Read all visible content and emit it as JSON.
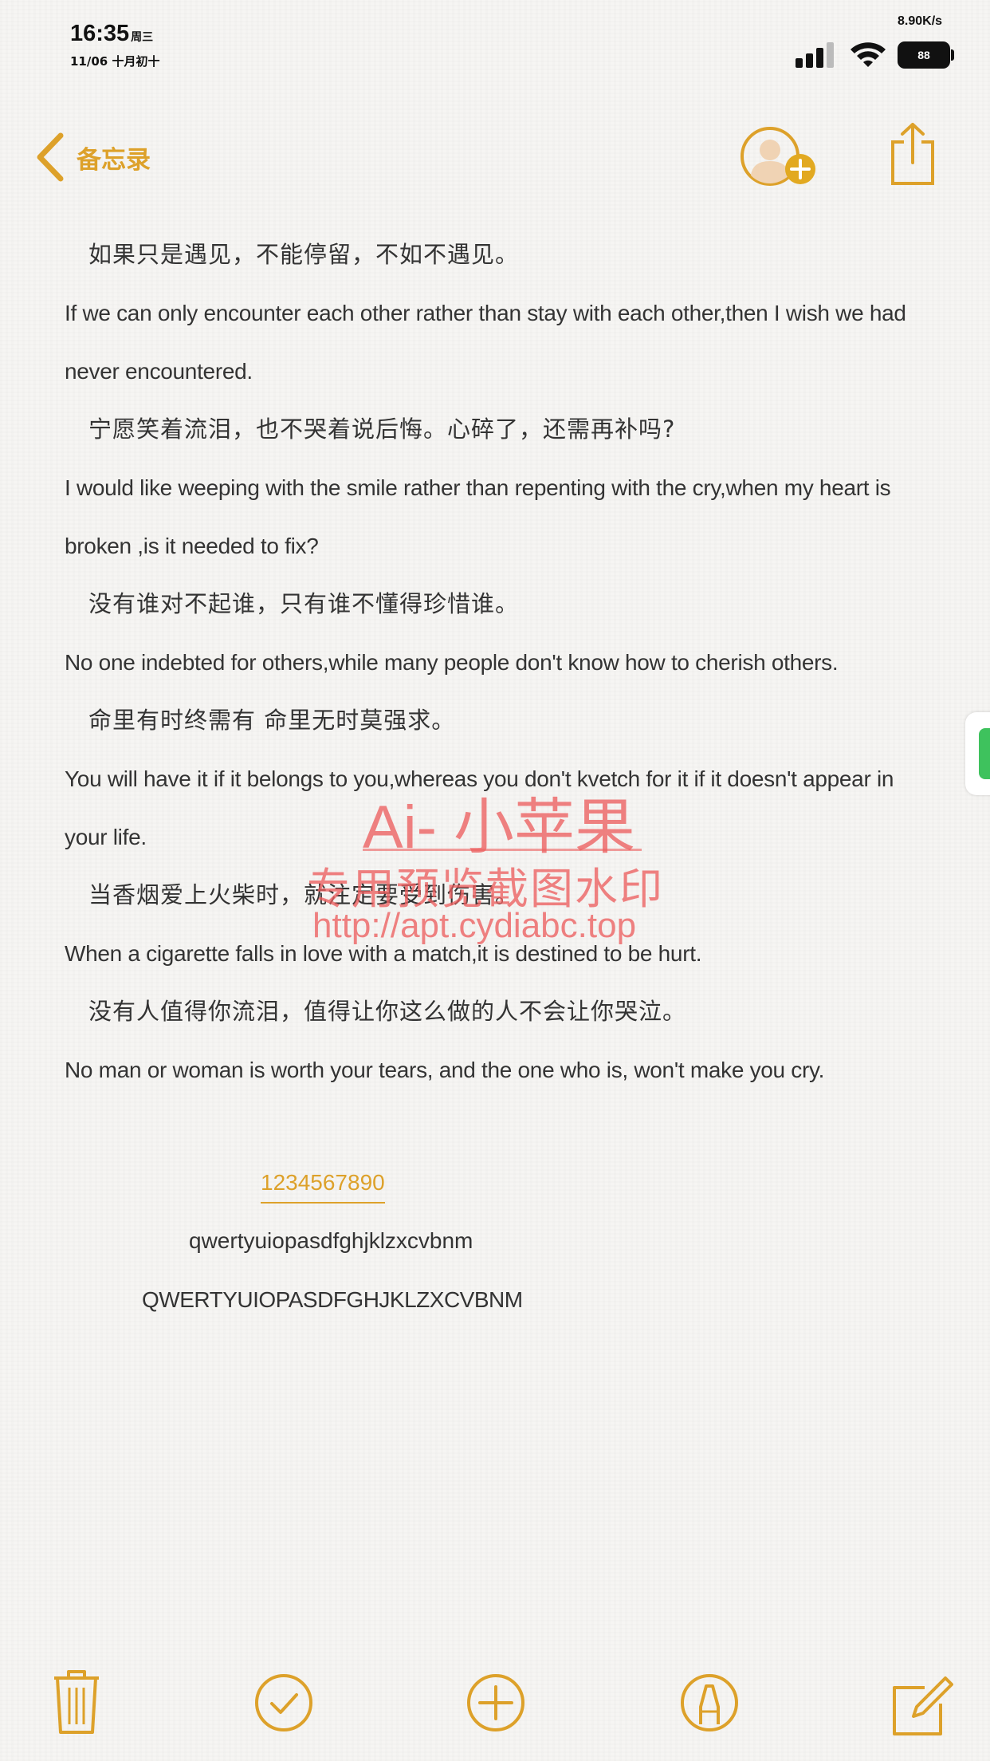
{
  "status_bar": {
    "time": "16:35",
    "weekday": "周三",
    "date": "11/06 十月初十",
    "net_speed": "8.90K/s",
    "battery": "88"
  },
  "nav": {
    "back_label": "备忘录"
  },
  "note": {
    "lines": [
      {
        "lang": "cn",
        "text": "如果只是遇见，不能停留，不如不遇见。"
      },
      {
        "lang": "en",
        "text": "If we can only encounter each other rather than stay with each other,then I wish we had"
      },
      {
        "lang": "en",
        "text": "never encountered."
      },
      {
        "lang": "cn",
        "text": "宁愿笑着流泪，也不哭着说后悔。心碎了，还需再补吗?"
      },
      {
        "lang": "en",
        "text": "I would like weeping with the smile rather than repenting with the cry,when my heart is"
      },
      {
        "lang": "en",
        "text": "broken ,is it needed to fix?"
      },
      {
        "lang": "cn",
        "text": "没有谁对不起谁，只有谁不懂得珍惜谁。"
      },
      {
        "lang": "en",
        "text": "No one indebted for others,while many people don't know how to cherish others."
      },
      {
        "lang": "cn",
        "text": "命里有时终需有 命里无时莫强求。"
      },
      {
        "lang": "en",
        "text": "You will have it if it belongs to you,whereas you don't kvetch for it if it doesn't appear in"
      },
      {
        "lang": "en",
        "text": "your life."
      },
      {
        "lang": "cn",
        "text": "当香烟爱上火柴时，就注定要受到伤害。"
      },
      {
        "lang": "en",
        "text": "When a cigarette falls in love with a match,it is destined to be hurt."
      },
      {
        "lang": "cn",
        "text": "没有人值得你流泪，值得让你这么做的人不会让你哭泣。"
      },
      {
        "lang": "en",
        "text": "No man or woman is worth your tears, and the one who is, won't make you cry."
      }
    ],
    "digits": "1234567890",
    "lowercase": "qwertyuiopasdfghjklzxcvbnm",
    "uppercase": "QWERTYUIOPASDFGHJKLZXCVBNM"
  },
  "watermark": {
    "line1": "Ai- 小苹果",
    "line2": "专用预览截图水印",
    "line3": "http://apt.cydiabc.top"
  },
  "colors": {
    "accent": "#dda12a",
    "watermark": "#ec5f5f",
    "background": "#f6f5f3"
  },
  "icons": [
    "chevron-left-icon",
    "add-person-icon",
    "share-icon",
    "trash-icon",
    "checklist-icon",
    "add-icon",
    "markup-icon",
    "compose-icon"
  ]
}
